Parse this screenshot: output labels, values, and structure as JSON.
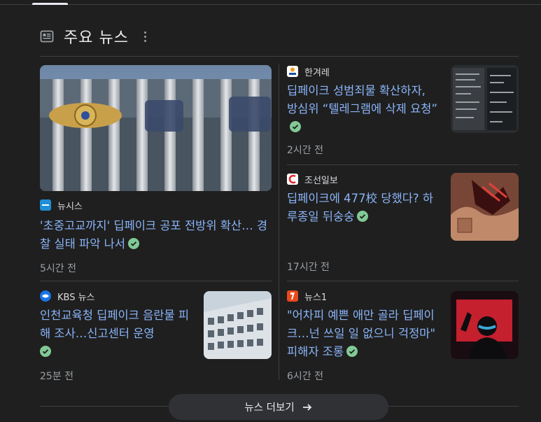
{
  "section": {
    "title": "주요 뉴스"
  },
  "articles": [
    {
      "source": "뉴시스",
      "headline": "'초중고교까지' 딥페이크 공포 전방위 확산… 경찰 실태 파악 나서",
      "time": "5시간 전"
    },
    {
      "source": "한겨레",
      "headline": "딥페이크 성범죄물 확산하자, 방심위 “텔레그램에 삭제 요청”",
      "time": "2시간 전"
    },
    {
      "source": "조선일보",
      "headline": "딥페이크에 477校 당했다? 하루종일 뒤숭숭",
      "time": "17시간 전"
    },
    {
      "source": "KBS 뉴스",
      "headline": "인천교육청 딥페이크 음란물 피해 조사…신고센터 운영",
      "time": "25분 전"
    },
    {
      "source": "뉴스1",
      "headline": "\"어차피 예쁜 애만 골라 딥페이크…넌 쓰일 일 없으니 걱정마\" 피해자 조롱",
      "time": "6시간 전"
    }
  ],
  "more_button": {
    "label": "뉴스 더보기"
  }
}
